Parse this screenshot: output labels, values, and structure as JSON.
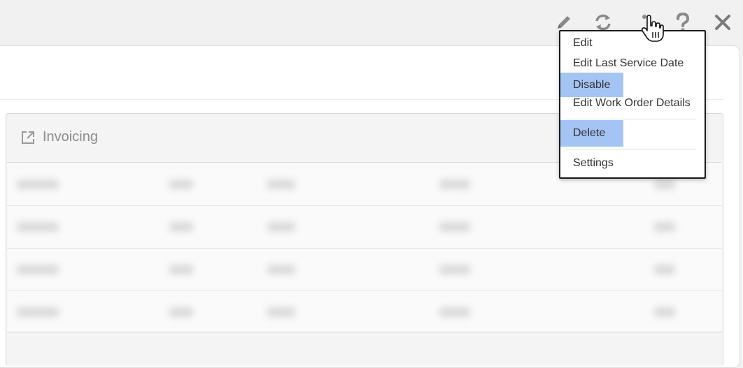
{
  "toolbar": {
    "icons": [
      "pencil-icon",
      "refresh-icon",
      "more-vertical-icon",
      "help-icon",
      "close-icon"
    ]
  },
  "card": {
    "title": "Invoicing",
    "icon": "external-link-icon"
  },
  "menu": {
    "items": [
      {
        "label": "Edit"
      },
      {
        "label": "Edit Last Service Date"
      },
      {
        "label": "Disable"
      },
      {
        "label": "Edit Work Order Details"
      },
      {
        "label": "Delete"
      },
      {
        "label": "Settings"
      }
    ],
    "highlight_color": "#a4c5f4"
  }
}
